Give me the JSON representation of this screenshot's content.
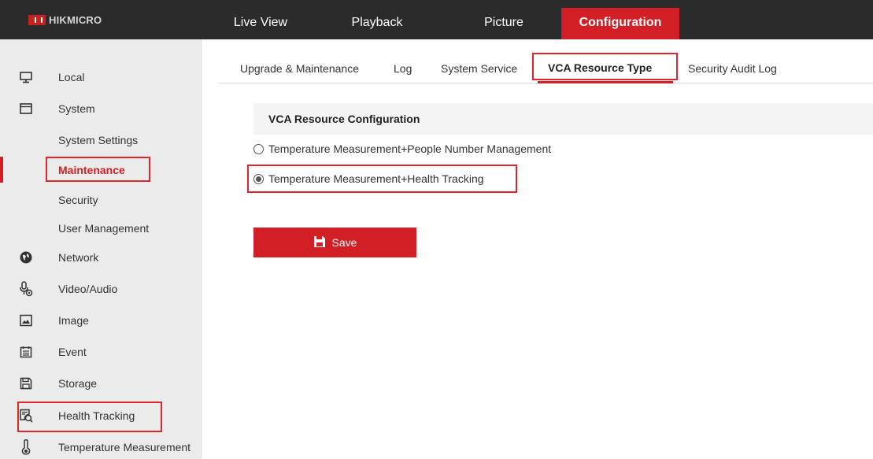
{
  "brand": {
    "name": "HIKMICRO"
  },
  "nav": {
    "tabs": [
      {
        "label": "Live View"
      },
      {
        "label": "Playback"
      },
      {
        "label": "Picture"
      },
      {
        "label": "Configuration",
        "active": true
      }
    ]
  },
  "sidebar": {
    "items": [
      {
        "label": "Local",
        "icon": "monitor-icon"
      },
      {
        "label": "System",
        "icon": "window-icon"
      },
      {
        "label": "System Settings"
      },
      {
        "label": "Maintenance",
        "active": true
      },
      {
        "label": "Security"
      },
      {
        "label": "User Management"
      },
      {
        "label": "Network",
        "icon": "globe-icon"
      },
      {
        "label": "Video/Audio",
        "icon": "microphone-icon"
      },
      {
        "label": "Image",
        "icon": "image-icon"
      },
      {
        "label": "Event",
        "icon": "calendar-icon"
      },
      {
        "label": "Storage",
        "icon": "save-disk-icon"
      },
      {
        "label": "Health Tracking",
        "icon": "health-tracking-icon"
      },
      {
        "label": "Temperature Measurement",
        "icon": "thermometer-icon"
      }
    ]
  },
  "subtabs": [
    {
      "label": "Upgrade & Maintenance"
    },
    {
      "label": "Log"
    },
    {
      "label": "System Service"
    },
    {
      "label": "VCA Resource Type",
      "active": true
    },
    {
      "label": "Security Audit Log"
    }
  ],
  "content": {
    "section_title": "VCA Resource Configuration",
    "options": [
      {
        "label": "Temperature Measurement+People Number Management",
        "selected": false
      },
      {
        "label": "Temperature Measurement+Health Tracking",
        "selected": true
      }
    ],
    "save_label": "Save"
  },
  "colors": {
    "accent": "#d11f25",
    "topbar": "#2b2b2b",
    "sidebar": "#ebebeb",
    "highlight_box": "#e0262d"
  }
}
